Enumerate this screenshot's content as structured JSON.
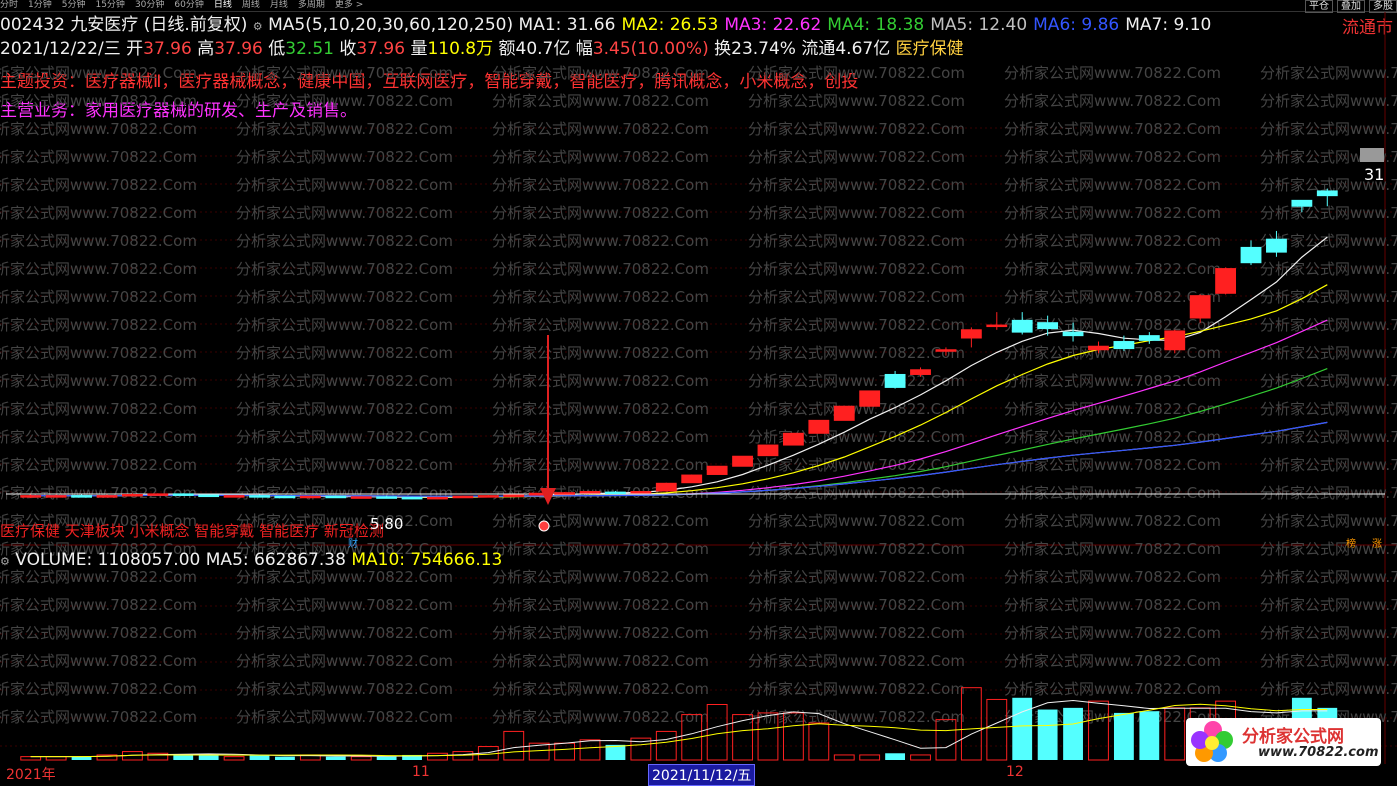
{
  "toolbar": {
    "tabs": [
      "分时",
      "1分钟",
      "5分钟",
      "15分钟",
      "30分钟",
      "60分钟",
      "日线",
      "周线",
      "月线",
      "多周期",
      "更多 >"
    ],
    "active": "日线",
    "right_tabs": [
      "平仓",
      "叠加",
      "多股"
    ]
  },
  "header": {
    "code": "002432",
    "name": "九安医疗",
    "period": "(日线.前复权)",
    "ma_label": "MA5(5,10,20,30,60,120,250)",
    "ma": [
      {
        "label": "MA1:",
        "value": "31.66",
        "color": "#f0f0f0"
      },
      {
        "label": "MA2:",
        "value": "26.53",
        "color": "#ffff00"
      },
      {
        "label": "MA3:",
        "value": "22.62",
        "color": "#ff33ff"
      },
      {
        "label": "MA4:",
        "value": "18.38",
        "color": "#33cc33"
      },
      {
        "label": "MA5:",
        "value": "12.40",
        "color": "#c0c0c0"
      },
      {
        "label": "MA6:",
        "value": "9.86",
        "color": "#3355ff"
      },
      {
        "label": "MA7:",
        "value": "9.10",
        "color": "#f0f0f0"
      }
    ],
    "liutong_btn": "流通市",
    "date": "2021/12/22/三",
    "open_label": "开",
    "open": "37.96",
    "high_label": "高",
    "high": "37.96",
    "low_label": "低",
    "low": "32.51",
    "close_label": "收",
    "close": "37.96",
    "vol_label": "量",
    "vol": "110.8万",
    "amount_label": "额",
    "amount": "40.7亿",
    "range_label": "幅",
    "range": "3.45(10.00%)",
    "turnover_label": "换",
    "turnover": "23.74%",
    "float_label": "流通",
    "float": "4.67亿",
    "sector": "医疗保健",
    "themes": "主题投资：医疗器械Ⅱ，医疗器械概念，健康中国，互联网医疗，智能穿戴，智能医疗，腾讯概念，小米概念，创投",
    "business": "主营业务：家用医疗器械的研发、生产及销售。"
  },
  "concepts": "医疗保健 天津板块 小米概念 智能穿戴 智能医疗 新冠检测",
  "price_markers": {
    "low_label": "5.80",
    "cai": "财",
    "high_label": "31",
    "bang": "榜",
    "zhang": "涨"
  },
  "volume_header": {
    "label": "VOLUME: 1108057.00",
    "ma5": "MA5: 662867.38",
    "ma10": "MA10: 754666.13"
  },
  "timebar": {
    "year": "2021年",
    "month11": "11",
    "cursor": "2021/11/12/五",
    "month12": "12"
  },
  "watermark": "分析家公式网www.70822.Com",
  "logo": {
    "title": "分析家公式网",
    "url": "www.70822.com"
  },
  "colors": {
    "up": "#ff2020",
    "down": "#54ffff",
    "bg": "#000000"
  },
  "chart_data": {
    "type": "candlestick",
    "title": "002432 九安医疗 (日线.前复权)",
    "price_ylim": [
      4,
      38
    ],
    "candles": [
      {
        "o": 5.8,
        "h": 6.0,
        "l": 5.7,
        "c": 5.9
      },
      {
        "o": 5.9,
        "h": 6.0,
        "l": 5.8,
        "c": 5.9
      },
      {
        "o": 5.9,
        "h": 6.0,
        "l": 5.8,
        "c": 5.85
      },
      {
        "o": 5.85,
        "h": 6.0,
        "l": 5.8,
        "c": 5.9
      },
      {
        "o": 5.95,
        "h": 6.1,
        "l": 5.9,
        "c": 6.0
      },
      {
        "o": 6.0,
        "h": 6.1,
        "l": 5.9,
        "c": 6.05
      },
      {
        "o": 6.05,
        "h": 6.1,
        "l": 5.9,
        "c": 5.95
      },
      {
        "o": 5.95,
        "h": 6.0,
        "l": 5.8,
        "c": 5.85
      },
      {
        "o": 5.85,
        "h": 5.95,
        "l": 5.8,
        "c": 5.9
      },
      {
        "o": 5.9,
        "h": 6.0,
        "l": 5.8,
        "c": 5.85
      },
      {
        "o": 5.85,
        "h": 5.9,
        "l": 5.75,
        "c": 5.8
      },
      {
        "o": 5.8,
        "h": 5.9,
        "l": 5.7,
        "c": 5.85
      },
      {
        "o": 5.85,
        "h": 5.9,
        "l": 5.7,
        "c": 5.75
      },
      {
        "o": 5.75,
        "h": 5.85,
        "l": 5.65,
        "c": 5.8
      },
      {
        "o": 5.8,
        "h": 5.9,
        "l": 5.7,
        "c": 5.75
      },
      {
        "o": 5.75,
        "h": 5.8,
        "l": 5.6,
        "c": 5.7
      },
      {
        "o": 5.7,
        "h": 5.8,
        "l": 5.6,
        "c": 5.75
      },
      {
        "o": 5.75,
        "h": 5.9,
        "l": 5.7,
        "c": 5.85
      },
      {
        "o": 5.85,
        "h": 5.95,
        "l": 5.8,
        "c": 5.9
      },
      {
        "o": 5.9,
        "h": 6.0,
        "l": 5.8,
        "c": 5.95
      },
      {
        "o": 5.95,
        "h": 6.1,
        "l": 5.9,
        "c": 6.1
      },
      {
        "o": 6.1,
        "h": 6.2,
        "l": 6.0,
        "c": 6.15
      },
      {
        "o": 6.15,
        "h": 6.3,
        "l": 6.1,
        "c": 6.25
      },
      {
        "o": 6.2,
        "h": 6.3,
        "l": 6.1,
        "c": 6.15
      },
      {
        "o": 6.15,
        "h": 6.3,
        "l": 6.1,
        "c": 6.25
      },
      {
        "o": 6.3,
        "h": 7.0,
        "l": 6.3,
        "c": 6.95
      },
      {
        "o": 7.0,
        "h": 7.7,
        "l": 7.0,
        "c": 7.65
      },
      {
        "o": 7.7,
        "h": 8.4,
        "l": 7.7,
        "c": 8.4
      },
      {
        "o": 8.4,
        "h": 9.25,
        "l": 8.4,
        "c": 9.25
      },
      {
        "o": 9.3,
        "h": 10.2,
        "l": 9.3,
        "c": 10.2
      },
      {
        "o": 10.2,
        "h": 11.2,
        "l": 10.2,
        "c": 11.2
      },
      {
        "o": 11.2,
        "h": 12.3,
        "l": 11.2,
        "c": 12.3
      },
      {
        "o": 12.3,
        "h": 13.5,
        "l": 12.3,
        "c": 13.5
      },
      {
        "o": 13.5,
        "h": 14.8,
        "l": 13.5,
        "c": 14.8
      },
      {
        "o": 16.2,
        "h": 16.5,
        "l": 15.0,
        "c": 15.1
      },
      {
        "o": 16.2,
        "h": 16.8,
        "l": 16.0,
        "c": 16.6
      },
      {
        "o": 18.2,
        "h": 18.5,
        "l": 17.8,
        "c": 18.3
      },
      {
        "o": 19.3,
        "h": 20.2,
        "l": 18.5,
        "c": 20.0
      },
      {
        "o": 20.3,
        "h": 21.5,
        "l": 20.0,
        "c": 20.4
      },
      {
        "o": 20.8,
        "h": 21.5,
        "l": 19.6,
        "c": 19.8
      },
      {
        "o": 20.6,
        "h": 21.2,
        "l": 19.5,
        "c": 20.1
      },
      {
        "o": 19.8,
        "h": 20.6,
        "l": 19.0,
        "c": 19.5
      },
      {
        "o": 18.3,
        "h": 19.0,
        "l": 18.0,
        "c": 18.6
      },
      {
        "o": 19.0,
        "h": 19.5,
        "l": 18.2,
        "c": 18.4
      },
      {
        "o": 19.5,
        "h": 19.8,
        "l": 18.8,
        "c": 19.1
      },
      {
        "o": 18.3,
        "h": 20.0,
        "l": 18.0,
        "c": 19.9
      },
      {
        "o": 21.0,
        "h": 23.0,
        "l": 20.6,
        "c": 22.9
      },
      {
        "o": 23.1,
        "h": 25.3,
        "l": 23.0,
        "c": 25.2
      },
      {
        "o": 27.0,
        "h": 27.6,
        "l": 25.5,
        "c": 25.7
      },
      {
        "o": 27.7,
        "h": 28.4,
        "l": 26.2,
        "c": 26.6
      },
      {
        "o": 31.0,
        "h": 31.0,
        "l": 30.0,
        "c": 30.5
      },
      {
        "o": 31.8,
        "h": 32.0,
        "l": 30.5,
        "c": 31.4
      }
    ],
    "volumes": [
      2,
      2,
      2,
      3,
      5,
      4,
      3,
      3,
      2,
      3,
      2,
      3,
      2,
      2,
      2,
      3,
      4,
      5,
      8,
      17,
      10,
      10,
      12,
      9,
      13,
      17,
      27,
      33,
      27,
      28,
      28,
      22,
      3,
      3,
      4,
      3,
      24,
      43,
      36,
      37,
      30,
      31,
      35,
      28,
      29,
      31,
      31,
      35,
      18,
      25,
      37,
      31
    ],
    "volume_ylim": [
      0,
      110
    ]
  }
}
